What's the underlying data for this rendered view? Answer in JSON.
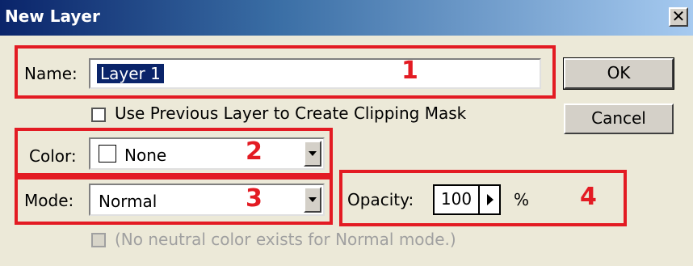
{
  "window": {
    "title": "New Layer",
    "close_glyph": "✕"
  },
  "name_field": {
    "label": "Name:",
    "value": "Layer 1"
  },
  "clipping_checkbox": {
    "label": "Use Previous Layer to Create Clipping Mask",
    "checked": false
  },
  "color_field": {
    "label": "Color:",
    "value": "None"
  },
  "mode_field": {
    "label": "Mode:",
    "value": "Normal"
  },
  "opacity_field": {
    "label": "Opacity:",
    "value": "100",
    "unit": "%"
  },
  "neutral_checkbox": {
    "label": "(No neutral color exists for Normal mode.)",
    "checked": false,
    "enabled": false
  },
  "buttons": {
    "ok": "OK",
    "cancel": "Cancel"
  },
  "annotations": [
    {
      "number": "1"
    },
    {
      "number": "2"
    },
    {
      "number": "3"
    },
    {
      "number": "4"
    }
  ],
  "colors": {
    "annotation_red": "#e31b23",
    "title_start": "#0a246a",
    "dialog_bg": "#ece9d8"
  }
}
